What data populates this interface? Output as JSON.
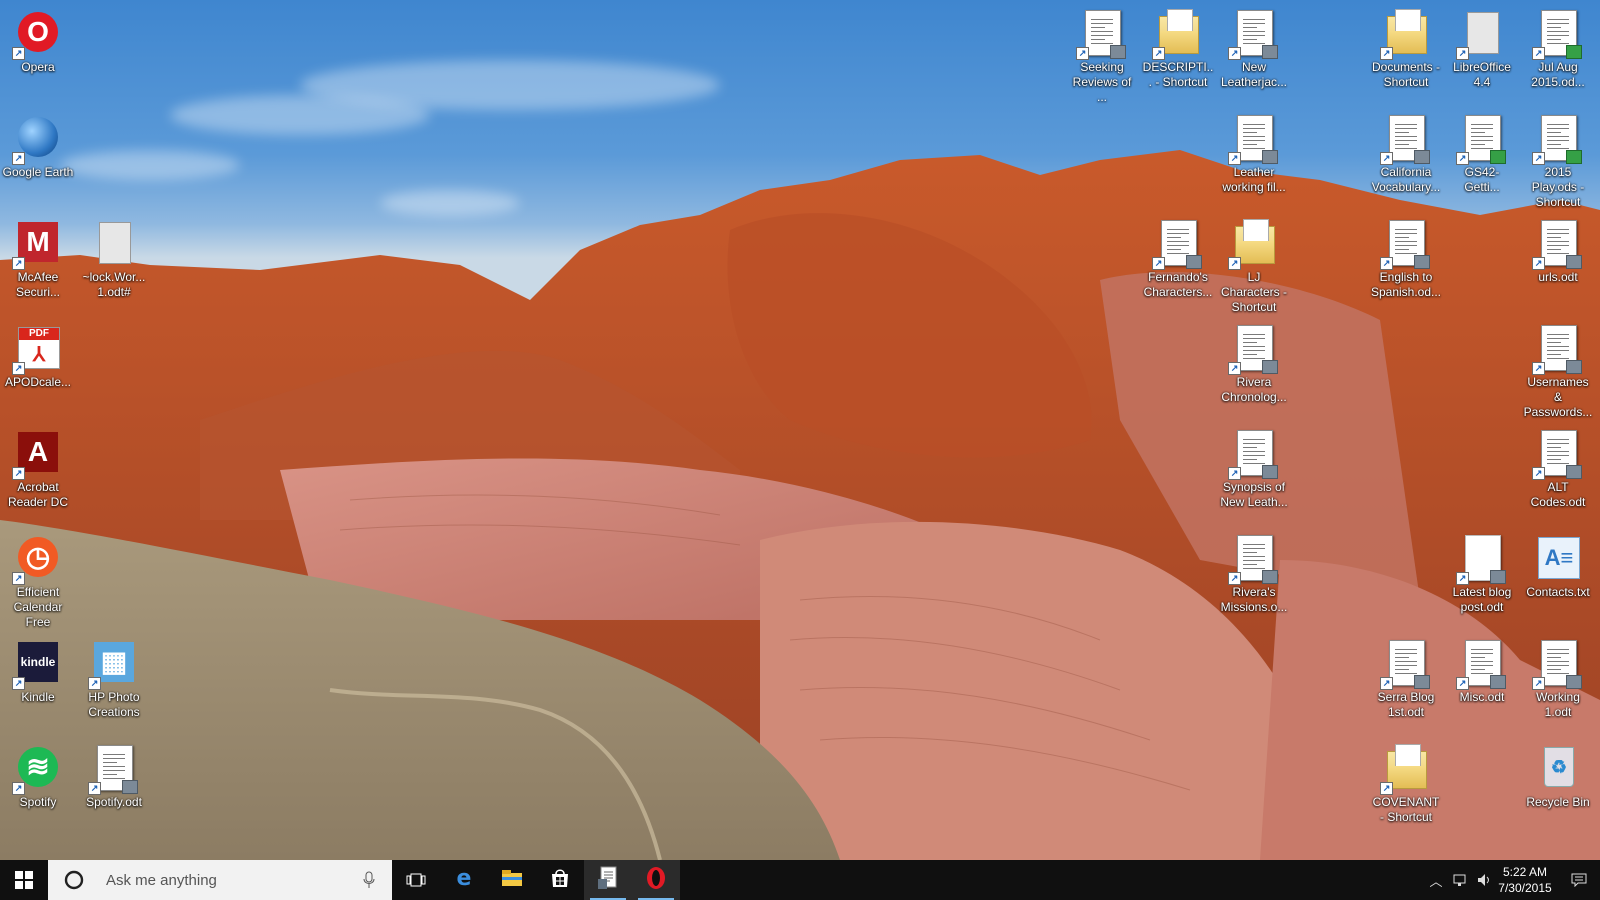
{
  "desktop": {
    "icons_left": [
      {
        "label": "Opera",
        "icon": "opera-icon",
        "kind": "round",
        "color": "#e11a25",
        "glyph": "O"
      },
      {
        "label": "Google Earth",
        "icon": "google-earth-icon",
        "kind": "round",
        "color": "#2f78c4",
        "glyph": ""
      },
      {
        "label": "McAfee Securi...",
        "icon": "mcafee-icon",
        "kind": "sq",
        "color": "#c0262d",
        "glyph": "M"
      },
      {
        "label": "~lock.Wor... 1.odt#",
        "icon": "file-icon",
        "kind": "gray",
        "color": "#e7e7e7",
        "glyph": ""
      },
      {
        "label": "APODcale...",
        "icon": "pdf-icon",
        "kind": "pdf",
        "color": "#d9261c",
        "glyph": "PDF"
      },
      {
        "label": "Acrobat Reader DC",
        "icon": "acrobat-reader-icon",
        "kind": "sq",
        "color": "#8b0f0b",
        "glyph": "A"
      },
      {
        "label": "Efficient Calendar Free",
        "icon": "clock-calendar-icon",
        "kind": "round",
        "color": "#f15a24",
        "glyph": "◷"
      },
      {
        "label": "Kindle",
        "icon": "kindle-icon",
        "kind": "sq",
        "color": "#1b1b3a",
        "glyph": "kindle"
      },
      {
        "label": "HP Photo Creations",
        "icon": "hp-photo-creations-icon",
        "kind": "sq",
        "color": "#5aa7de",
        "glyph": "▦"
      },
      {
        "label": "Spotify",
        "icon": "spotify-icon",
        "kind": "round",
        "color": "#1db954",
        "glyph": "≋"
      },
      {
        "label": "Spotify.odt",
        "icon": "document-icon",
        "kind": "doc",
        "color": "#ffffff",
        "glyph": ""
      }
    ],
    "icons_right": [
      {
        "label": "Seeking Reviews of ...",
        "icon": "document-icon",
        "kind": "doc"
      },
      {
        "label": "DESCRIPTI... - Shortcut",
        "icon": "folder-icon",
        "kind": "folder"
      },
      {
        "label": "New Leatherjac...",
        "icon": "document-icon",
        "kind": "doc"
      },
      {
        "label": "Documents - Shortcut",
        "icon": "folder-icon",
        "kind": "folder"
      },
      {
        "label": "LibreOffice 4.4",
        "icon": "libreoffice-icon",
        "kind": "gray"
      },
      {
        "label": "Jul Aug 2015.od...",
        "icon": "spreadsheet-icon",
        "kind": "sheet"
      },
      {
        "label": "Leather working fil...",
        "icon": "document-icon",
        "kind": "doc"
      },
      {
        "label": "California Vocabulary...",
        "icon": "document-icon",
        "kind": "doc"
      },
      {
        "label": "GS42- Getti...",
        "icon": "spreadsheet-icon",
        "kind": "sheet"
      },
      {
        "label": "2015 Play.ods - Shortcut",
        "icon": "spreadsheet-icon",
        "kind": "sheet"
      },
      {
        "label": "Fernando's Characters...",
        "icon": "document-icon",
        "kind": "doc"
      },
      {
        "label": "LJ Characters - Shortcut",
        "icon": "folder-icon",
        "kind": "folder"
      },
      {
        "label": "English to Spanish.od...",
        "icon": "document-icon",
        "kind": "doc"
      },
      {
        "label": "urls.odt",
        "icon": "document-icon",
        "kind": "doc"
      },
      {
        "label": "Rivera Chronolog...",
        "icon": "document-icon",
        "kind": "doc"
      },
      {
        "label": "Usernames & Passwords...",
        "icon": "document-icon",
        "kind": "doc"
      },
      {
        "label": "Synopsis of New Leath...",
        "icon": "document-icon",
        "kind": "doc"
      },
      {
        "label": "ALT Codes.odt",
        "icon": "document-icon",
        "kind": "doc"
      },
      {
        "label": "Rivera's Missions.o...",
        "icon": "document-icon",
        "kind": "doc"
      },
      {
        "label": "Latest blog post.odt",
        "icon": "document-icon",
        "kind": "blank"
      },
      {
        "label": "Contacts.txt",
        "icon": "contacts-icon",
        "kind": "contacts"
      },
      {
        "label": "Serra Blog 1st.odt",
        "icon": "document-icon",
        "kind": "doc"
      },
      {
        "label": "Misc.odt",
        "icon": "document-icon",
        "kind": "doc"
      },
      {
        "label": "Working 1.odt",
        "icon": "document-icon",
        "kind": "doc"
      },
      {
        "label": "COVENANT - Shortcut",
        "icon": "folder-icon",
        "kind": "folder"
      },
      {
        "label": "Recycle Bin",
        "icon": "recycle-bin-icon",
        "kind": "bin"
      }
    ]
  },
  "taskbar": {
    "search_placeholder": "Ask me anything",
    "pinned": [
      {
        "name": "edge-icon",
        "active": false
      },
      {
        "name": "file-explorer-icon",
        "active": false
      },
      {
        "name": "store-icon",
        "active": false
      },
      {
        "name": "document-app-icon",
        "active": true
      },
      {
        "name": "opera-icon",
        "active": true
      }
    ],
    "clock_time": "5:22 AM",
    "clock_date": "7/30/2015"
  },
  "colors": {
    "taskbar_bg": "#101010",
    "accent": "#76b9ed",
    "rock": "#c0582f",
    "sky": "#4a8fd4"
  }
}
